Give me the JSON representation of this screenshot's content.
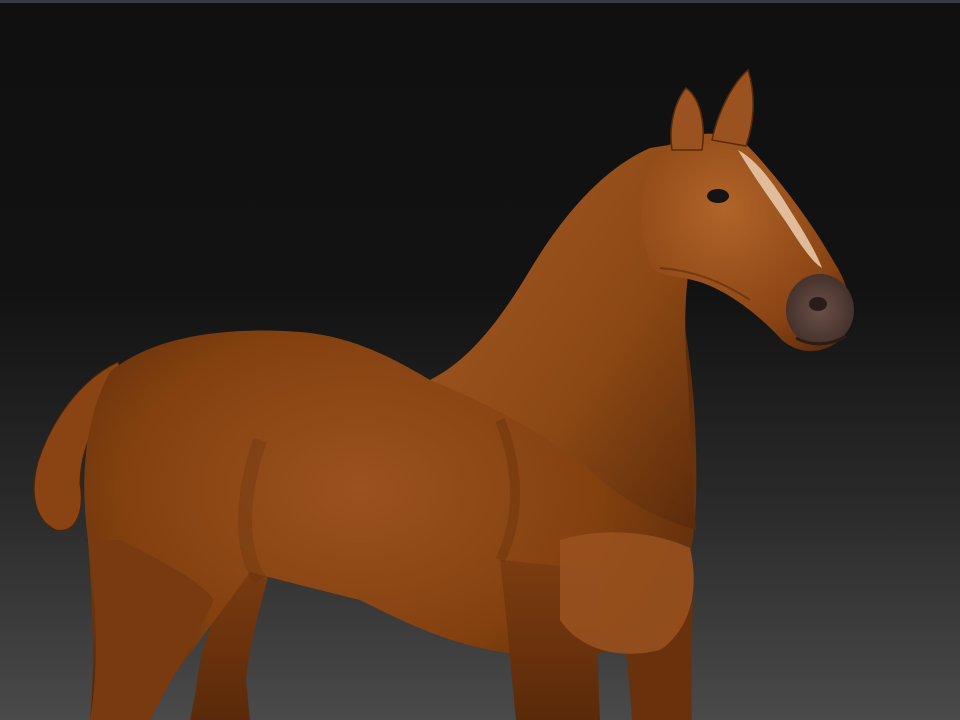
{
  "viewport": {
    "label": "",
    "model_name": "horse-sculpt",
    "background_top": "#101010",
    "background_bottom": "#4a4a4a",
    "model_colors": {
      "coat": "#8a4416",
      "coat_highlight": "#b86a2e",
      "coat_shadow": "#4a2108",
      "blaze": "#e8c8a8",
      "muzzle": "#5a4a44",
      "eye": "#141414"
    }
  }
}
